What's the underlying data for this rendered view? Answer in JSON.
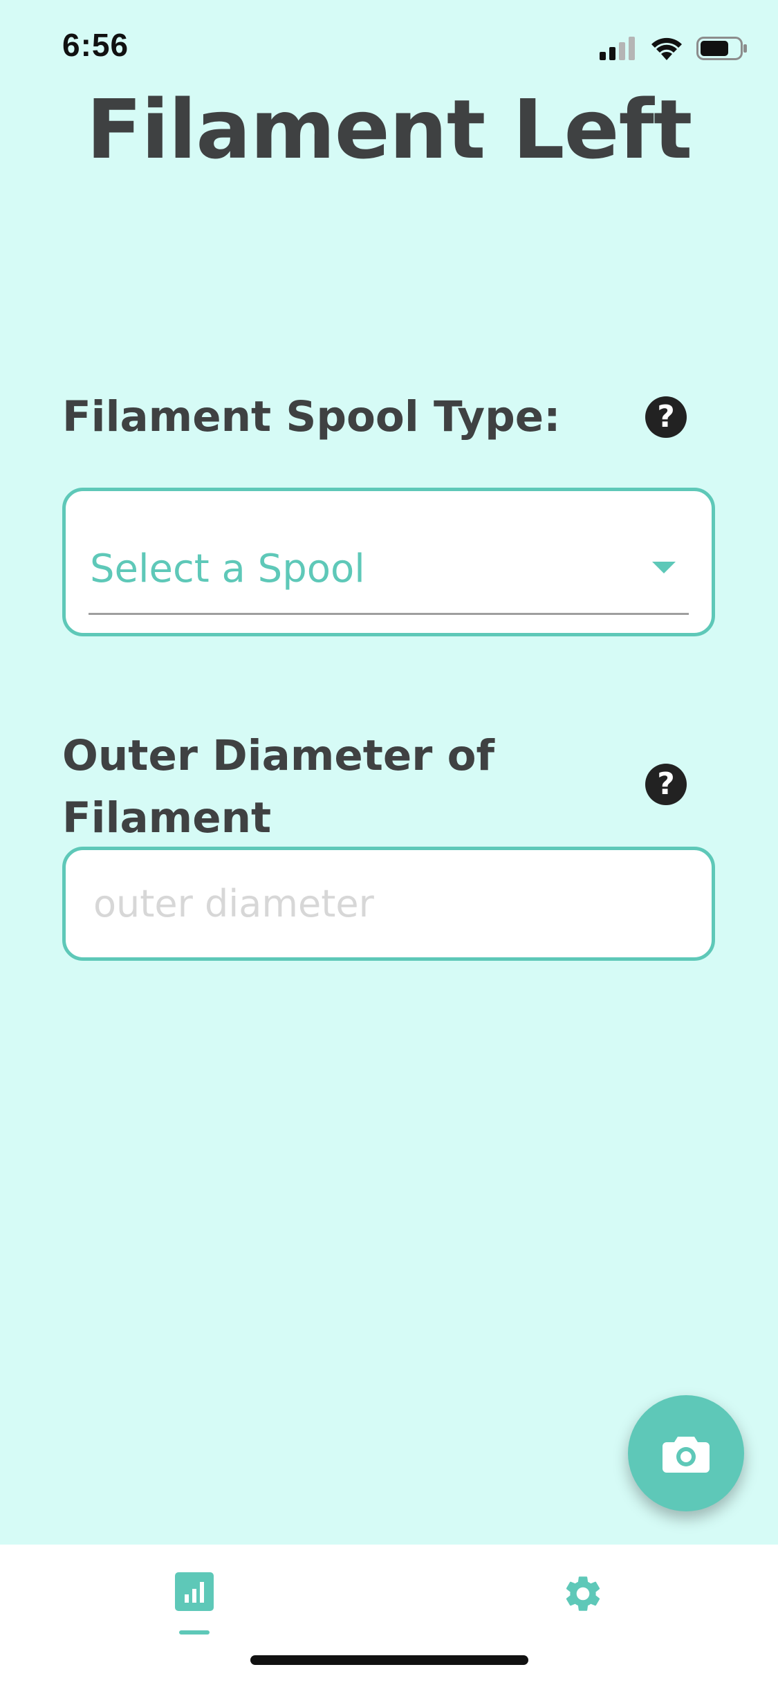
{
  "status_bar": {
    "time": "6:56",
    "icons": [
      "cellular-signal-icon",
      "wifi-icon",
      "battery-icon"
    ]
  },
  "header": {
    "title": "Filament Left"
  },
  "form": {
    "spool_type": {
      "label": "Filament Spool Type:",
      "help_icon": "question-circle-icon",
      "selected_value": "Select a Spool"
    },
    "outer_diameter": {
      "label": "Outer Diameter of Filament Remaining(mm):",
      "help_icon": "question-circle-icon",
      "value": "",
      "placeholder": "outer diameter"
    }
  },
  "fab": {
    "icon": "camera-icon"
  },
  "tab_bar": {
    "tabs": [
      {
        "icon": "bar-chart-icon",
        "selected": true
      },
      {
        "icon": "gear-icon",
        "selected": false
      }
    ]
  },
  "colors": {
    "background": "#d6fbf6",
    "accent": "#5ec8b8",
    "text": "#3f4142",
    "placeholder": "#d7d7d7"
  }
}
